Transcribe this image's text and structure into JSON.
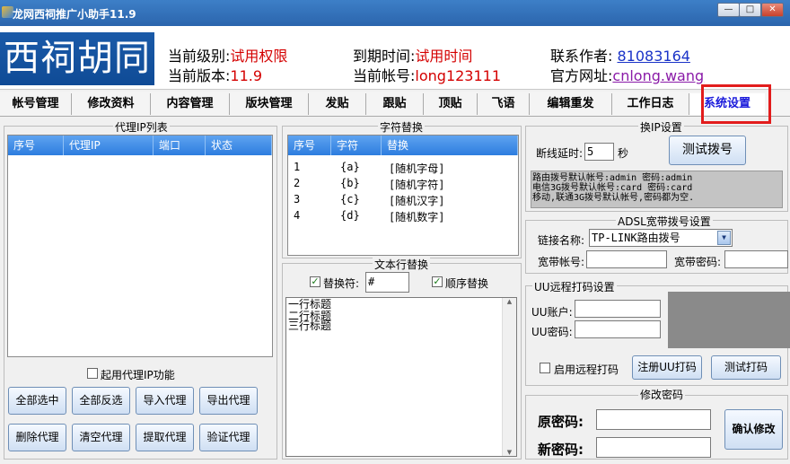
{
  "window": {
    "title": "龙网西祠推广小助手11.9",
    "minimize": "—",
    "maximize": "□",
    "close": "✕"
  },
  "header": {
    "logo": "西祠胡同",
    "level_label": "当前级别:",
    "level_value": "试用权限",
    "version_label": "当前版本:",
    "version_value": "11.9",
    "expire_label": "到期时间:",
    "expire_value": "试用时间",
    "account_label": "当前帐号:",
    "account_value": "long123111",
    "contact_label": "联系作者: ",
    "contact_value": "81083164",
    "site_label": "官方网址:",
    "site_value": "cnlong.wang"
  },
  "tabs": [
    "帐号管理",
    "修改资料",
    "内容管理",
    "版块管理",
    "发贴",
    "跟贴",
    "顶贴",
    "飞语",
    "编辑重发",
    "工作日志",
    "系统设置"
  ],
  "proxy": {
    "title": "代理IP列表",
    "columns": [
      "序号",
      "代理IP",
      "端口",
      "状态"
    ],
    "use_proxy_label": "起用代理IP功能",
    "buttons": [
      "全部选中",
      "全部反选",
      "导入代理",
      "导出代理",
      "删除代理",
      "清空代理",
      "提取代理",
      "验证代理"
    ]
  },
  "char_replace": {
    "title": "字符替换",
    "columns": [
      "序号",
      "字符",
      "替换"
    ],
    "rows": [
      {
        "no": "1",
        "char": "{a}",
        "rep": "[随机字母]"
      },
      {
        "no": "2",
        "char": "{b}",
        "rep": "[随机字符]"
      },
      {
        "no": "3",
        "char": "{c}",
        "rep": "[随机汉字]"
      },
      {
        "no": "4",
        "char": "{d}",
        "rep": "[随机数字]"
      }
    ]
  },
  "text_line": {
    "title": "文本行替换",
    "replace_label": "替换符:",
    "replace_value": "#",
    "order_label": "顺序替换",
    "lines": [
      "一行标题",
      "二行标题",
      "三行标题"
    ]
  },
  "ip_switch": {
    "title": "换IP设置",
    "delay_label": "断线延时:",
    "delay_value": "5",
    "delay_unit": "秒",
    "test_button": "测试拨号",
    "info_lines": [
      "路由拨号默认帐号:admin 密码:admin",
      "电信3G拨号默认帐号:card 密码:card",
      "移动,联通3G拨号默认帐号,密码都为空."
    ]
  },
  "adsl": {
    "title": "ADSL宽带拨号设置",
    "link_label": "链接名称:",
    "link_value": "TP-LINK路由拨号",
    "account_label": "宽带帐号:",
    "password_label": "宽带密码:"
  },
  "uu": {
    "title": "UU远程打码设置",
    "account_label": "UU账户:",
    "password_label": "UU密码:",
    "enable_label": "启用远程打码",
    "register_button": "注册UU打码",
    "test_button": "测试打码"
  },
  "password": {
    "title": "修改密码",
    "old_label": "原密码:",
    "new_label": "新密码:",
    "confirm_button": "确认修改"
  }
}
